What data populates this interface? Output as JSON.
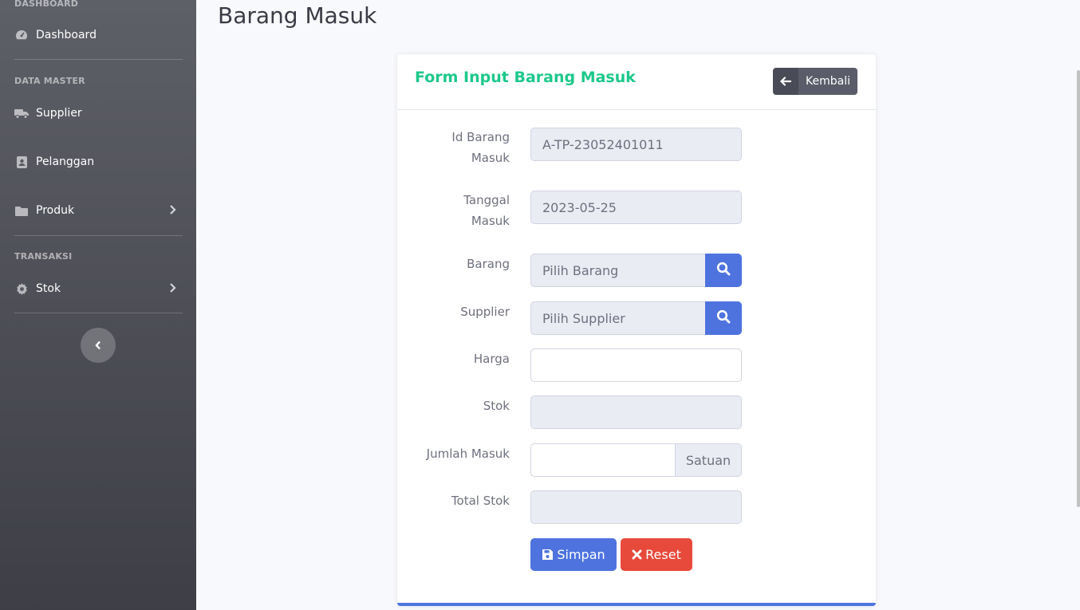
{
  "sidebar": {
    "heading_dashboard": "DASHBOARD",
    "dashboard_label": "Dashboard",
    "heading_master": "DATA MASTER",
    "supplier_label": "Supplier",
    "pelanggan_label": "Pelanggan",
    "produk_label": "Produk",
    "heading_transaksi": "TRANSAKSI",
    "stok_label": "Stok"
  },
  "page": {
    "title": "Barang Masuk"
  },
  "form": {
    "title": "Form Input Barang Masuk",
    "back_label": "Kembali",
    "id_label_line1": "Id Barang",
    "id_label_line2": "Masuk",
    "id_value": "A-TP-23052401011",
    "tanggal_label_line1": "Tanggal",
    "tanggal_label_line2": "Masuk",
    "tanggal_value": "2023-05-25",
    "barang_label": "Barang",
    "barang_placeholder": "Pilih Barang",
    "supplier_label": "Supplier",
    "supplier_placeholder": "Pilih Supplier",
    "harga_label": "Harga",
    "harga_value": "",
    "stok_label": "Stok",
    "stok_value": "",
    "jumlah_label": "Jumlah Masuk",
    "jumlah_value": "",
    "satuan_label": "Satuan",
    "total_label": "Total Stok",
    "total_value": "",
    "save_label": "Simpan",
    "reset_label": "Reset"
  },
  "colors": {
    "primary": "#4e73df",
    "success": "#1cc88a",
    "danger": "#e74a3b",
    "sidebar": "#5a5c69"
  },
  "icons": {
    "dashboard": "tachometer-icon",
    "supplier": "truck-icon",
    "pelanggan": "address-card-icon",
    "produk": "folder-icon",
    "stok": "gear-icon",
    "back": "arrow-left-icon",
    "search": "search-icon",
    "save": "floppy-disk-icon",
    "reset": "times-icon"
  }
}
